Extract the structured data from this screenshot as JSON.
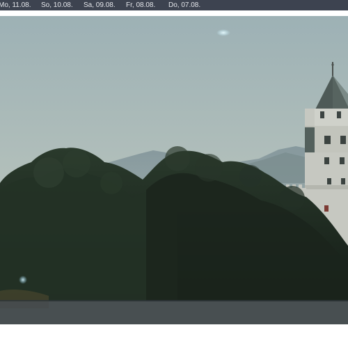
{
  "date_tabs": [
    {
      "label": "Mo, 11.08."
    },
    {
      "label": "So, 10.08."
    },
    {
      "label": "Sa, 09.08."
    },
    {
      "label": "Fr, 08.08."
    },
    {
      "label": "Do, 07.08."
    }
  ],
  "colors": {
    "date_bar_bg": "#3d4350",
    "date_text": "#e6e8ec",
    "sky_top": "#9eb2b6",
    "sky_bottom": "#b9c2ba",
    "foliage": "#1f2a22",
    "tower": "#c9cbc4",
    "control_bar": "#2e363a"
  },
  "webcam": {
    "scene": "castle-tower-with-trees-and-mountains"
  }
}
